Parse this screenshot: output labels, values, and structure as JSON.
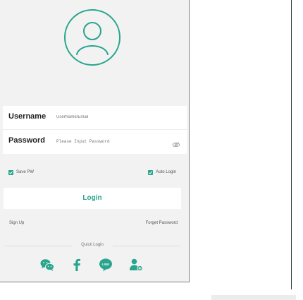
{
  "login": {
    "username_label": "Username",
    "username_placeholder": "UserName/Email",
    "password_label": "Password",
    "password_placeholder": "Please Input Password",
    "save_pw_label": "Save PW",
    "save_pw_checked": true,
    "auto_login_label": "Auto Login",
    "auto_login_checked": true,
    "login_button": "Login",
    "sign_up_link": "Sign Up",
    "forget_password_link": "Forget Password",
    "quick_login_label": "Quick Login"
  },
  "icons": {
    "avatar": "user-avatar-icon",
    "eye": "eye-icon",
    "social": [
      "wechat-icon",
      "facebook-icon",
      "line-icon",
      "contact-icon"
    ]
  },
  "colors": {
    "accent": "#27a58d",
    "background": "#f2f2f2",
    "card": "#ffffff"
  }
}
